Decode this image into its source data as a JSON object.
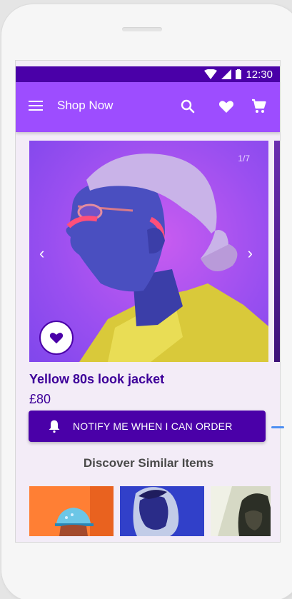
{
  "status": {
    "time": "12:30"
  },
  "appbar": {
    "title": "Shop Now",
    "icons": [
      "menu-icon",
      "search-icon",
      "heart-icon",
      "cart-icon"
    ]
  },
  "product": {
    "image_counter": "1/7",
    "name": "Yellow 80s look jacket",
    "price": "£80"
  },
  "notify": {
    "label": "NOTIFY ME WHEN I CAN ORDER"
  },
  "similar": {
    "title": "Discover Similar Items"
  },
  "colors": {
    "primary": "#4a00a8",
    "appbar": "#9d4dff",
    "background": "#f3ecf7"
  }
}
